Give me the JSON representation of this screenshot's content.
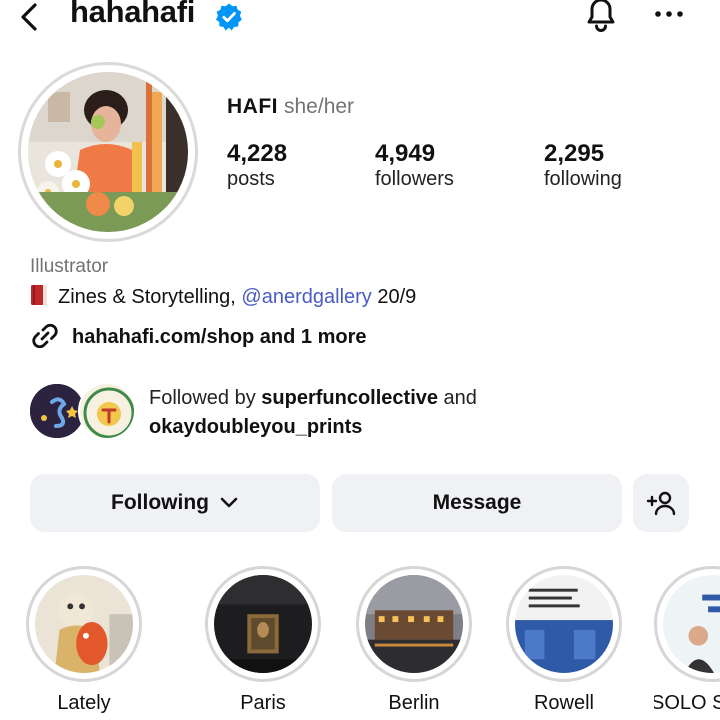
{
  "header": {
    "username": "hahahafi",
    "back_icon": "chevron-left-icon",
    "verified_icon": "verified-badge-icon",
    "bell_icon": "bell-icon",
    "more_icon": "more-horizontal-icon"
  },
  "profile": {
    "display_name": "HAFI",
    "pronouns": "she/her",
    "stats": [
      {
        "value": "4,228",
        "label": "posts"
      },
      {
        "value": "4,949",
        "label": "followers"
      },
      {
        "value": "2,295",
        "label": "following"
      }
    ],
    "category": "Illustrator",
    "bio_text": "Zines & Storytelling, ",
    "bio_mention": "@anerdgallery",
    "bio_suffix": " 20/9",
    "link": "hahahafi.com/shop and 1 more"
  },
  "followed_by": {
    "prefix": "Followed by ",
    "user1": "superfuncollective",
    "middle": " and",
    "user2": "okaydoubleyou_prints"
  },
  "actions": {
    "following": "Following",
    "message": "Message",
    "add_user_icon": "add-user-icon"
  },
  "highlights": [
    {
      "label": "Lately"
    },
    {
      "label": "Paris"
    },
    {
      "label": "Berlin"
    },
    {
      "label": "Rowell"
    },
    {
      "label": "SOLO S"
    }
  ],
  "colors": {
    "verified": "#0095f6",
    "mention": "#4a5bc4",
    "button_bg": "#eff1f4",
    "muted_text": "#737373"
  }
}
